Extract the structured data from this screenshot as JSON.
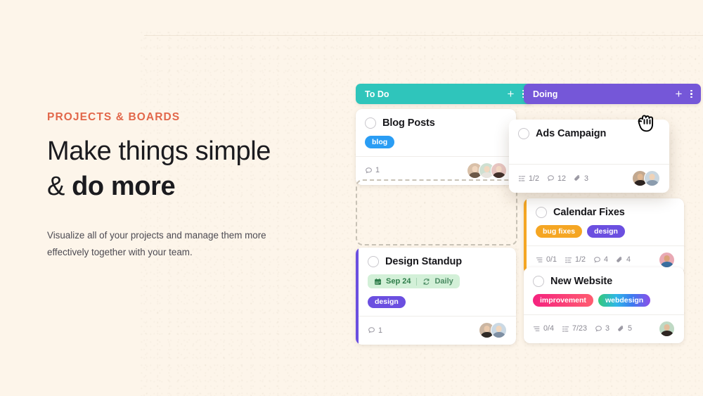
{
  "hero": {
    "eyebrow": "PROJECTS & BOARDS",
    "headline_line1": "Make things simple",
    "headline_line2_prefix": "& ",
    "headline_line2_bold": "do more",
    "subcopy": "Visualize all of your projects and manage them more effectively together with your team."
  },
  "colors": {
    "page_background": "#FDF5EA",
    "eyebrow": "#E2674A",
    "todo_header": "#2FC5BB",
    "doing_header": "#7557D8",
    "tag_blog": "#2A9DF4",
    "tag_design": "#6B4FE0",
    "tag_bug_fixes": "#F5A623",
    "accent_standup": "#6B4FE0",
    "accent_calendar": "#F5A623",
    "datechip_background": "#D3F0D8",
    "datechip_text": "#2E7D4A"
  },
  "board": {
    "columns": [
      {
        "name": "todo",
        "title": "To Do",
        "add_icon": "plus-icon",
        "menu_icon": "kebab-menu-icon"
      },
      {
        "name": "doing",
        "title": "Doing",
        "add_icon": "plus-icon",
        "menu_icon": "kebab-menu-icon"
      }
    ],
    "cards": [
      {
        "id": "blog-posts",
        "title": "Blog Posts",
        "tags": [
          {
            "label": "blog",
            "style": "blog"
          }
        ],
        "meta": [
          {
            "icon": "comment-icon",
            "value": "1"
          }
        ],
        "avatar_count": 3
      },
      {
        "id": "design-standup",
        "title": "Design Standup",
        "date_chip": {
          "calendar_icon": "calendar-icon",
          "date": "Sep 24",
          "repeat_icon": "repeat-icon",
          "repeat_label": "Daily"
        },
        "tags": [
          {
            "label": "design",
            "style": "design"
          }
        ],
        "meta": [
          {
            "icon": "comment-icon",
            "value": "1"
          }
        ],
        "avatar_count": 2
      },
      {
        "id": "ads-campaign",
        "title": "Ads Campaign",
        "tags": [],
        "meta": [
          {
            "icon": "checklist-icon",
            "value": "1/2"
          },
          {
            "icon": "comment-icon",
            "value": "12"
          },
          {
            "icon": "attachment-icon",
            "value": "3"
          }
        ],
        "avatar_count": 2,
        "dragging": true
      },
      {
        "id": "calendar-fixes",
        "title": "Calendar Fixes",
        "tags": [
          {
            "label": "bug fixes",
            "style": "bugfixes"
          },
          {
            "label": "design",
            "style": "design"
          }
        ],
        "meta": [
          {
            "icon": "subtask-icon",
            "value": "0/1"
          },
          {
            "icon": "checklist-icon",
            "value": "1/2"
          },
          {
            "icon": "comment-icon",
            "value": "4"
          },
          {
            "icon": "attachment-icon",
            "value": "4"
          }
        ],
        "avatar_count": 1
      },
      {
        "id": "new-website",
        "title": "New Website",
        "tags": [
          {
            "label": "improvement",
            "style": "improvement"
          },
          {
            "label": "webdesign",
            "style": "webdesign"
          }
        ],
        "meta": [
          {
            "icon": "subtask-icon",
            "value": "0/4"
          },
          {
            "icon": "checklist-icon",
            "value": "7/23"
          },
          {
            "icon": "comment-icon",
            "value": "3"
          },
          {
            "icon": "attachment-icon",
            "value": "5"
          }
        ],
        "avatar_count": 1
      }
    ],
    "dropzone": {
      "name": "card-drop-placeholder"
    },
    "cursor": {
      "icon": "grabbing-hand-cursor"
    }
  }
}
